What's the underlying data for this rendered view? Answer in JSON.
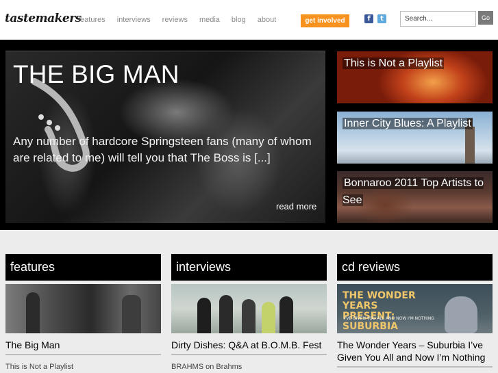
{
  "header": {
    "logo": "tastemakers",
    "nav": [
      "features",
      "interviews",
      "reviews",
      "media",
      "blog",
      "about"
    ],
    "cta": "get involved",
    "social": [
      {
        "name": "facebook",
        "glyph": "f"
      },
      {
        "name": "twitter",
        "glyph": "t"
      }
    ],
    "search": {
      "placeholder": "Search...",
      "value": ""
    },
    "go_label": "Go"
  },
  "hero": {
    "title": "THE BIG MAN",
    "excerpt": "Any number of hardcore Springsteen fans (many of whom are related to me) will tell you that The Boss is [...]",
    "read_more": "read more"
  },
  "side_stories": [
    {
      "title": "This is Not a Playlist"
    },
    {
      "title": "Inner City Blues: A Playlist"
    },
    {
      "title": "Bonnaroo 2011 Top Artists to See"
    }
  ],
  "columns": [
    {
      "heading": "features",
      "title": "The Big Man",
      "sub": "This is Not a Playlist"
    },
    {
      "heading": "interviews",
      "title": "Dirty Dishes: Q&A at B.O.M.B. Fest",
      "sub": "BRAHMS on Brahms"
    },
    {
      "heading": "cd reviews",
      "title": "The Wonder Years – Suburbia I’ve Given You All and Now I’m Nothing",
      "sub": "",
      "image_text": {
        "main": "THE WONDER YEARS PRESENT: SUBURBIA",
        "sub": "I'VE GIVEN YOU ALL AND NOW I'M NOTHING"
      }
    }
  ],
  "colors": {
    "accent": "#f7921e",
    "facebook": "#3b5998",
    "twitter": "#5ea9dd"
  }
}
